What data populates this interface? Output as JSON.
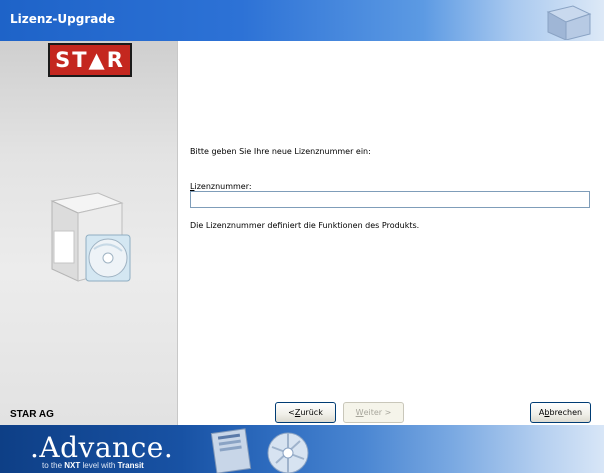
{
  "window": {
    "title": "Lizenz-Upgrade"
  },
  "sidebar": {
    "logo": "ST▲R",
    "company": "STAR AG"
  },
  "main": {
    "prompt": "Bitte geben Sie Ihre neue Lizenznummer ein:",
    "field_label_accel": "L",
    "field_label_rest": "izenznummer:",
    "field_value": "",
    "description": "Die Lizenznummer definiert die Funktionen des Produkts."
  },
  "buttons": {
    "back_prefix": "< ",
    "back_accel": "Z",
    "back_rest": "urück",
    "next_accel": "W",
    "next_rest": "eiter >",
    "cancel_prefix": "A",
    "cancel_accel": "b",
    "cancel_rest": "brechen"
  },
  "banner": {
    "headline": ".Advance.",
    "sub_prefix": "to the ",
    "sub_bold1": "NXT",
    "sub_middle": " level with ",
    "sub_bold2": "Transit"
  }
}
